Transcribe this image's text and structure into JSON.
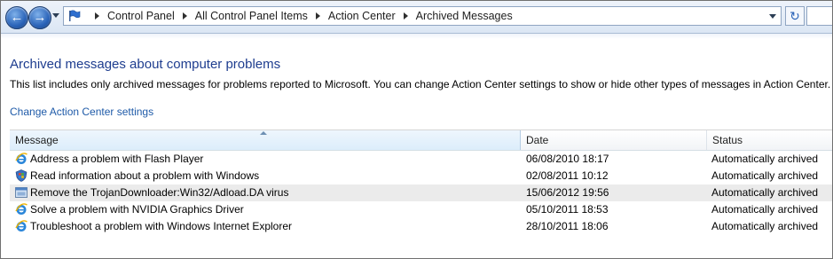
{
  "breadcrumbs": [
    "Control Panel",
    "All Control Panel Items",
    "Action Center",
    "Archived Messages"
  ],
  "page": {
    "heading": "Archived messages about computer problems",
    "description": "This list includes only archived messages for problems reported to Microsoft. You can change Action Center settings to show or hide other types of messages in Action Center.",
    "settings_link": "Change Action Center settings"
  },
  "table": {
    "columns": [
      "Message",
      "Date",
      "Status"
    ],
    "sort_column": "Message",
    "rows": [
      {
        "icon": "internet-explorer-icon",
        "message": "Address a problem with Flash Player",
        "date": "06/08/2010 18:17",
        "status": "Automatically archived"
      },
      {
        "icon": "windows-shield-icon",
        "message": "Read information about a problem with Windows",
        "date": "02/08/2011 10:12",
        "status": "Automatically archived"
      },
      {
        "icon": "window-app-icon",
        "message": "Remove the TrojanDownloader:Win32/Adload.DA virus",
        "date": "15/06/2012 19:56",
        "status": "Automatically archived",
        "selected": true
      },
      {
        "icon": "internet-explorer-icon",
        "message": "Solve a problem with NVIDIA Graphics Driver",
        "date": "05/10/2011 18:53",
        "status": "Automatically archived"
      },
      {
        "icon": "internet-explorer-icon",
        "message": "Troubleshoot a problem with Windows Internet Explorer",
        "date": "28/10/2011 18:06",
        "status": "Automatically archived"
      }
    ]
  },
  "colors": {
    "heading": "#1e3d8f",
    "link": "#1e5aa8",
    "selected_row": "#ebebeb"
  }
}
